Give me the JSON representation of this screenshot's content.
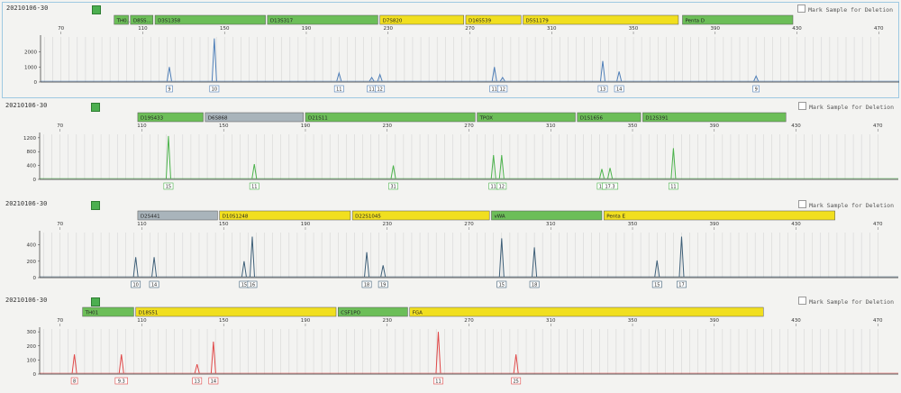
{
  "colors": {
    "green_marker": "#6cbe58",
    "yellow_marker": "#f1df1f",
    "gray_marker": "#a9b4bb",
    "grid": "#c8c8c8",
    "blue_trace": "#4f7fb8",
    "green_trace": "#4cb34c",
    "dark_trace": "#3e5f78",
    "red_trace": "#e04848"
  },
  "icons": {
    "flag": "green-square-icon",
    "checkbox": "checkbox-icon"
  },
  "mark_label": "Mark Sample for Deletion",
  "panels": [
    {
      "sample_name": "20210106-30",
      "trace_color": "#4f7fb8",
      "y_ticks": [
        "2000",
        "1000",
        "0"
      ],
      "y_max": 3000,
      "markers": [
        {
          "label": "TH0…",
          "color": "green",
          "from": 96,
          "to": 103
        },
        {
          "label": "D8SS…",
          "color": "green",
          "from": 104,
          "to": 115
        },
        {
          "label": "D3S1358",
          "color": "green",
          "from": 116,
          "to": 170
        },
        {
          "label": "D13S317",
          "color": "green",
          "from": 171,
          "to": 225
        },
        {
          "label": "D7S820",
          "color": "yellow",
          "from": 226,
          "to": 267
        },
        {
          "label": "D16S539",
          "color": "yellow",
          "from": 268,
          "to": 295
        },
        {
          "label": "D5S1179",
          "color": "yellow",
          "from": 296,
          "to": 372
        },
        {
          "label": "Penta D",
          "color": "green",
          "from": 374,
          "to": 428
        }
      ],
      "peaks": [
        {
          "x": 123,
          "h": 1000,
          "label": "9"
        },
        {
          "x": 145,
          "h": 2900,
          "label": "10"
        },
        {
          "x": 206,
          "h": 600,
          "label": "11"
        },
        {
          "x": 222,
          "h": 300,
          "label": "11"
        },
        {
          "x": 226,
          "h": 500,
          "label": "12"
        },
        {
          "x": 282,
          "h": 1000,
          "label": "11"
        },
        {
          "x": 286,
          "h": 300,
          "label": "12"
        },
        {
          "x": 335,
          "h": 1400,
          "label": "13"
        },
        {
          "x": 343,
          "h": 700,
          "label": "14"
        },
        {
          "x": 410,
          "h": 400,
          "label": "9"
        }
      ]
    },
    {
      "sample_name": "20210106-30",
      "trace_color": "#4cb34c",
      "y_ticks": [
        "1200",
        "800",
        "400",
        "0"
      ],
      "y_max": 1300,
      "markers": [
        {
          "label": "D19S433",
          "color": "green",
          "from": 108,
          "to": 140
        },
        {
          "label": "D6S868",
          "color": "gray",
          "from": 141,
          "to": 189
        },
        {
          "label": "D21S11",
          "color": "green",
          "from": 190,
          "to": 273
        },
        {
          "label": "TPOX",
          "color": "green",
          "from": 274,
          "to": 322
        },
        {
          "label": "D1S1656",
          "color": "green",
          "from": 323,
          "to": 354
        },
        {
          "label": "D12S391",
          "color": "green",
          "from": 355,
          "to": 425
        }
      ],
      "peaks": [
        {
          "x": 123,
          "h": 1250,
          "label": "15"
        },
        {
          "x": 165,
          "h": 440,
          "label": "11"
        },
        {
          "x": 233,
          "h": 400,
          "label": "31"
        },
        {
          "x": 282,
          "h": 700,
          "label": "11"
        },
        {
          "x": 286,
          "h": 700,
          "label": "12"
        },
        {
          "x": 335,
          "h": 300,
          "label": "16"
        },
        {
          "x": 339,
          "h": 330,
          "label": "17.3"
        },
        {
          "x": 370,
          "h": 900,
          "label": "11"
        }
      ]
    },
    {
      "sample_name": "20210106-30",
      "trace_color": "#3e5f78",
      "y_ticks": [
        "400",
        "200",
        "0"
      ],
      "y_max": 550,
      "markers": [
        {
          "label": "D2S441",
          "color": "gray",
          "from": 108,
          "to": 147
        },
        {
          "label": "D10S1248",
          "color": "yellow",
          "from": 148,
          "to": 212
        },
        {
          "label": "D22S1045",
          "color": "yellow",
          "from": 213,
          "to": 280
        },
        {
          "label": "vWA",
          "color": "green",
          "from": 281,
          "to": 335
        },
        {
          "label": "Penta E",
          "color": "yellow",
          "from": 336,
          "to": 449
        }
      ],
      "peaks": [
        {
          "x": 107,
          "h": 250,
          "label": "10"
        },
        {
          "x": 116,
          "h": 250,
          "label": "14"
        },
        {
          "x": 160,
          "h": 200,
          "label": "15"
        },
        {
          "x": 164,
          "h": 500,
          "label": "16"
        },
        {
          "x": 220,
          "h": 310,
          "label": "18"
        },
        {
          "x": 228,
          "h": 150,
          "label": "19"
        },
        {
          "x": 286,
          "h": 480,
          "label": "15"
        },
        {
          "x": 302,
          "h": 370,
          "label": "18"
        },
        {
          "x": 362,
          "h": 210,
          "label": "15"
        },
        {
          "x": 374,
          "h": 500,
          "label": "17"
        }
      ]
    },
    {
      "sample_name": "20210106-30",
      "trace_color": "#e04848",
      "y_ticks": [
        "300",
        "200",
        "100",
        "0"
      ],
      "y_max": 320,
      "markers": [
        {
          "label": "TH01",
          "color": "green",
          "from": 81,
          "to": 106
        },
        {
          "label": "D18S51",
          "color": "yellow",
          "from": 107,
          "to": 205
        },
        {
          "label": "CSF1PO",
          "color": "green",
          "from": 206,
          "to": 240
        },
        {
          "label": "FGA",
          "color": "yellow",
          "from": 241,
          "to": 414
        }
      ],
      "peaks": [
        {
          "x": 77,
          "h": 140,
          "label": "8"
        },
        {
          "x": 100,
          "h": 140,
          "label": "9.3"
        },
        {
          "x": 137,
          "h": 70,
          "label": "13"
        },
        {
          "x": 145,
          "h": 230,
          "label": "14"
        },
        {
          "x": 255,
          "h": 300,
          "label": "11"
        },
        {
          "x": 293,
          "h": 140,
          "label": "25"
        }
      ]
    }
  ],
  "x_axis_ticks": [
    "70",
    "110",
    "150",
    "190",
    "230",
    "270",
    "310",
    "350",
    "390",
    "430",
    "470"
  ]
}
